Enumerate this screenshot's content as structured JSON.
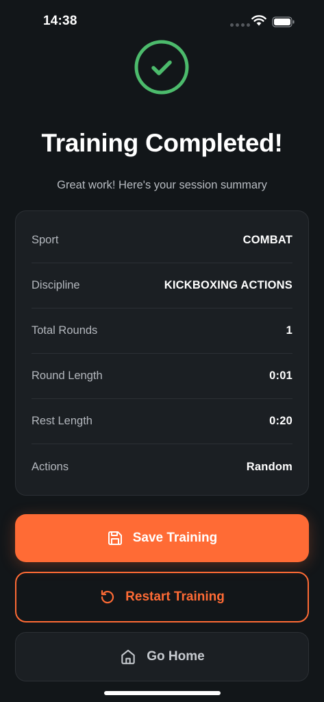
{
  "status_bar": {
    "time": "14:38"
  },
  "header": {
    "title": "Training Completed!",
    "subtitle": "Great work! Here's your session summary"
  },
  "summary": {
    "rows": [
      {
        "label": "Sport",
        "value": "COMBAT"
      },
      {
        "label": "Discipline",
        "value": "KICKBOXING ACTIONS"
      },
      {
        "label": "Total Rounds",
        "value": "1"
      },
      {
        "label": "Round Length",
        "value": "0:01"
      },
      {
        "label": "Rest Length",
        "value": "0:20"
      },
      {
        "label": "Actions",
        "value": "Random"
      }
    ]
  },
  "actions": {
    "save_label": "Save Training",
    "restart_label": "Restart Training",
    "home_label": "Go Home"
  },
  "icons": {
    "success": "check-circle-icon",
    "save": "save-icon",
    "restart": "restart-icon",
    "home": "home-icon"
  },
  "colors": {
    "background": "#121619",
    "card": "#1b1f23",
    "accent": "#ff6b35",
    "success": "#4cbb6c"
  }
}
